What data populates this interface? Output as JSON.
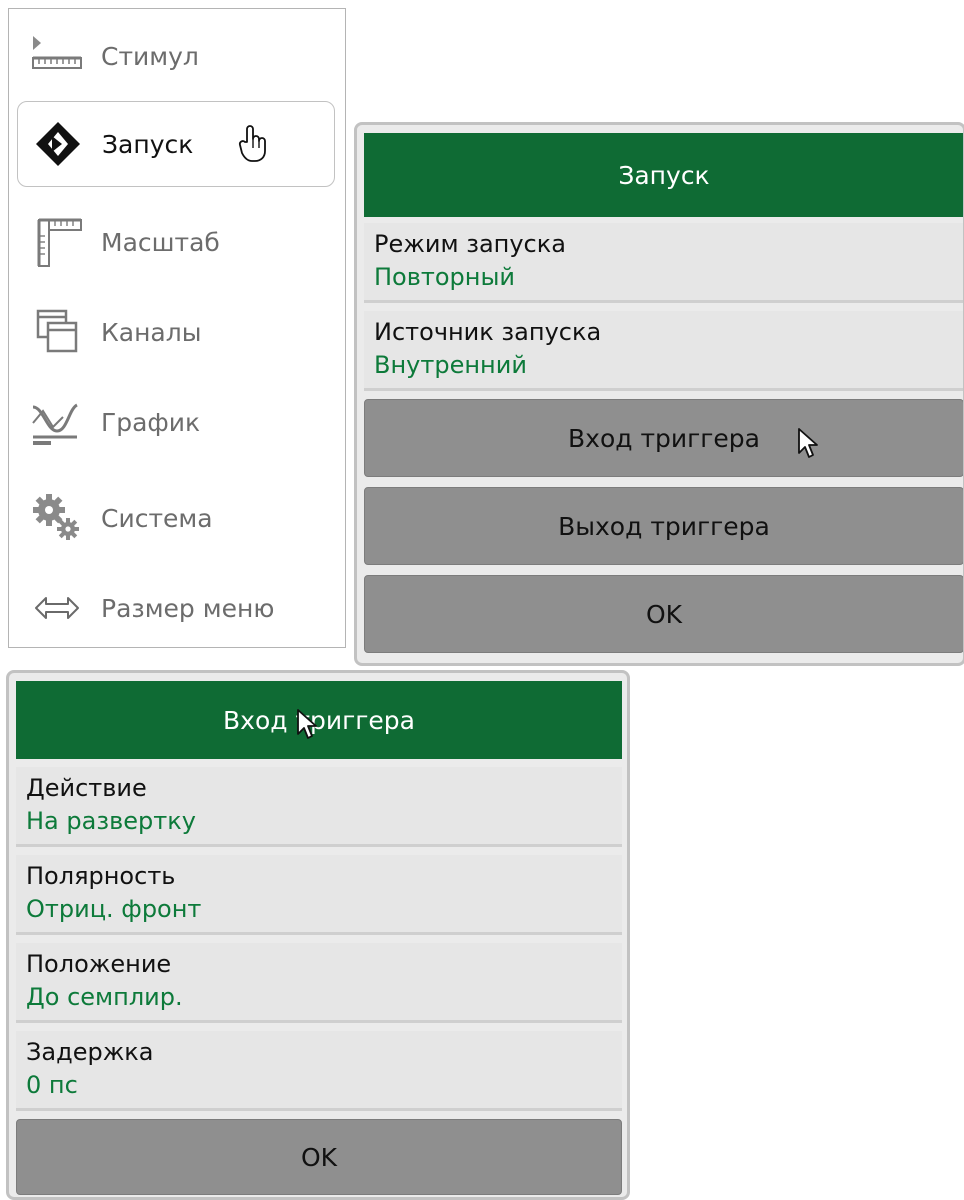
{
  "menu": {
    "items": [
      {
        "label": "Стимул",
        "icon": "ruler-stimulus-icon"
      },
      {
        "label": "Запуск",
        "icon": "trigger-diamond-icon"
      },
      {
        "label": "Масштаб",
        "icon": "scale-ruler-icon"
      },
      {
        "label": "Каналы",
        "icon": "channels-windows-icon"
      },
      {
        "label": "График",
        "icon": "trace-graph-icon"
      },
      {
        "label": "Система",
        "icon": "gears-icon"
      },
      {
        "label": "Размер меню",
        "icon": "resize-arrows-icon"
      }
    ],
    "active_index": 1
  },
  "trigger_panel": {
    "title": "Запуск",
    "fields": [
      {
        "label": "Режим запуска",
        "value": "Повторный"
      },
      {
        "label": "Источник запуска",
        "value": "Внутренний"
      }
    ],
    "buttons": [
      "Вход триггера",
      "Выход триггера",
      "OK"
    ]
  },
  "trigger_input_panel": {
    "title": "Вход триггера",
    "fields": [
      {
        "label": "Действие",
        "value": "На развертку"
      },
      {
        "label": "Полярность",
        "value": "Отриц. фронт"
      },
      {
        "label": "Положение",
        "value": "До семплир."
      },
      {
        "label": "Задержка",
        "value": "0 пс"
      }
    ],
    "ok_label": "OK"
  },
  "colors": {
    "header_green": "#0f6b34",
    "value_green": "#0d7a3a",
    "button_gray": "#8f8f8f",
    "panel_gray": "#ebebeb"
  }
}
